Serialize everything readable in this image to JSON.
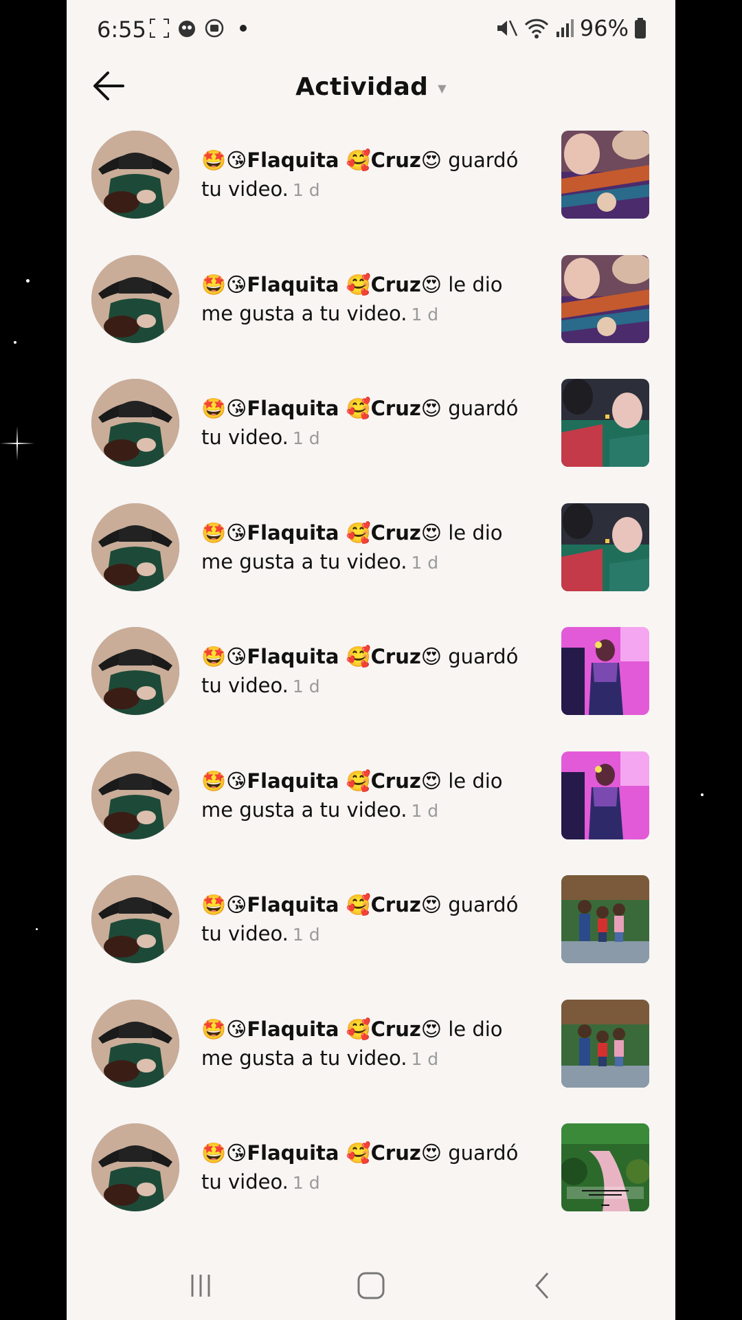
{
  "status_bar": {
    "time": "6:55",
    "battery": "96%",
    "icons": [
      "screenshot-icon",
      "app-icon",
      "media-icon",
      "notification-dot",
      "mute-icon",
      "wifi-icon",
      "signal-icon",
      "battery-icon"
    ]
  },
  "header": {
    "title": "Actividad",
    "back_icon": "arrow-left-icon",
    "dropdown_icon": "caret-down-icon"
  },
  "activities": [
    {
      "user": "🤩😘Flaquita 🥰Cruz😍",
      "action": "guardó tu video.",
      "time": "1 d",
      "thumb": "purple-dress"
    },
    {
      "user": "🤩😘Flaquita 🥰Cruz😍",
      "action": "le dio me gusta a tu video.",
      "time": "1 d",
      "thumb": "purple-dress"
    },
    {
      "user": "🤩😘Flaquita 🥰Cruz😍",
      "action": "guardó tu video.",
      "time": "1 d",
      "thumb": "green-dress"
    },
    {
      "user": "🤩😘Flaquita 🥰Cruz😍",
      "action": "le dio me gusta a tu video.",
      "time": "1 d",
      "thumb": "green-dress"
    },
    {
      "user": "🤩😘Flaquita 🥰Cruz😍",
      "action": "guardó tu video.",
      "time": "1 d",
      "thumb": "pink-room"
    },
    {
      "user": "🤩😘Flaquita 🥰Cruz😍",
      "action": "le dio me gusta a tu video.",
      "time": "1 d",
      "thumb": "pink-room"
    },
    {
      "user": "🤩😘Flaquita 🥰Cruz😍",
      "action": "guardó tu video.",
      "time": "1 d",
      "thumb": "kids-garden"
    },
    {
      "user": "🤩😘Flaquita 🥰Cruz😍",
      "action": "le dio me gusta a tu video.",
      "time": "1 d",
      "thumb": "kids-garden"
    },
    {
      "user": "🤩😘Flaquita 🥰Cruz😍",
      "action": "guardó tu video.",
      "time": "1 d",
      "thumb": "garden-path"
    }
  ],
  "navbar": {
    "recents": "recents-icon",
    "home": "home-icon",
    "back": "back-icon"
  }
}
